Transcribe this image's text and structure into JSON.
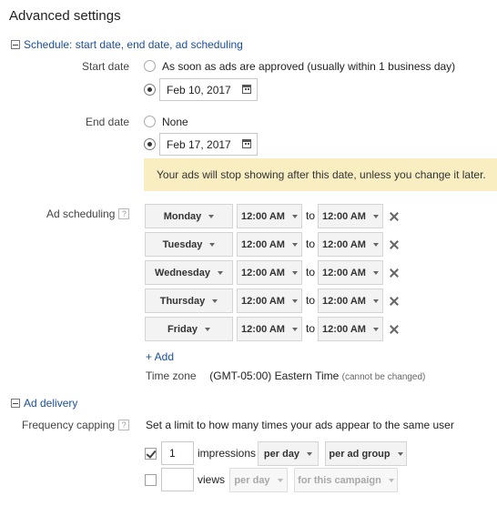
{
  "title": "Advanced settings",
  "schedule": {
    "section_label": "Schedule: start date, end date, ad scheduling",
    "start_date": {
      "label": "Start date",
      "option_asap": "As soon as ads are approved (usually within 1 business day)",
      "date_value": "Feb 10, 2017"
    },
    "end_date": {
      "label": "End date",
      "option_none": "None",
      "date_value": "Feb 17, 2017",
      "banner": "Your ads will stop showing after this date, unless you change it later."
    },
    "ad_scheduling": {
      "label": "Ad scheduling",
      "help": "?",
      "to_text": "to",
      "rows": [
        {
          "day": "Monday",
          "from": "12:00 AM",
          "to": "12:00 AM"
        },
        {
          "day": "Tuesday",
          "from": "12:00 AM",
          "to": "12:00 AM"
        },
        {
          "day": "Wednesday",
          "from": "12:00 AM",
          "to": "12:00 AM"
        },
        {
          "day": "Thursday",
          "from": "12:00 AM",
          "to": "12:00 AM"
        },
        {
          "day": "Friday",
          "from": "12:00 AM",
          "to": "12:00 AM"
        }
      ],
      "add_label": "+ Add",
      "timezone_label": "Time zone",
      "timezone_value": "(GMT-05:00) Eastern Time",
      "timezone_note": "(cannot be changed)"
    }
  },
  "ad_delivery": {
    "section_label": "Ad delivery",
    "frequency_capping": {
      "label": "Frequency capping",
      "help": "?",
      "description": "Set a limit to how many times your ads appear to the same user",
      "impressions": {
        "checked": true,
        "value": "1",
        "label": "impressions",
        "period": "per day",
        "scope": "per ad group"
      },
      "views": {
        "checked": false,
        "value": "",
        "label": "views",
        "period": "per day",
        "scope": "for this campaign"
      }
    }
  }
}
